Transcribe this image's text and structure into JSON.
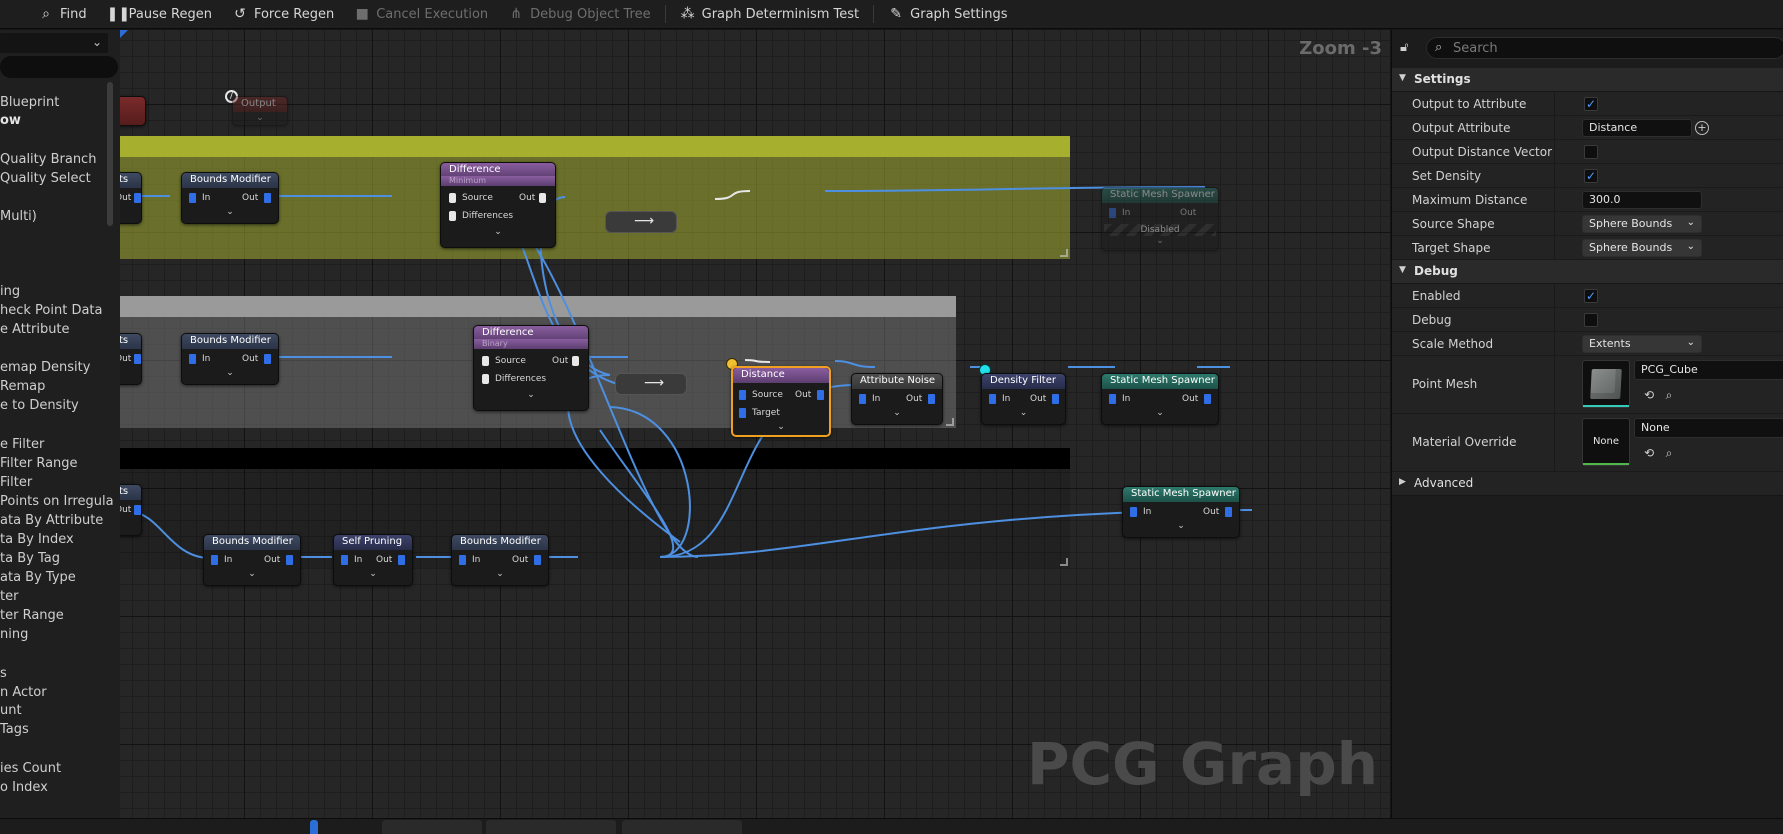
{
  "toolbar": {
    "items": [
      {
        "label": "Find",
        "icon": "find-icon",
        "enabled": true
      },
      {
        "label": "Pause Regen",
        "icon": "pause-icon",
        "enabled": true
      },
      {
        "label": "Force Regen",
        "icon": "refresh-icon",
        "enabled": true
      },
      {
        "label": "Cancel Execution",
        "icon": "stop-icon",
        "enabled": false
      },
      {
        "label": "Debug Object Tree",
        "icon": "debug-tree-icon",
        "enabled": false
      },
      {
        "label": "Graph Determinism Test",
        "icon": "determinism-icon",
        "enabled": true
      },
      {
        "label": "Graph Settings",
        "icon": "graph-settings-icon",
        "enabled": true
      }
    ]
  },
  "palette": {
    "items": [
      {
        "label": "Blueprint",
        "bold": false
      },
      {
        "label": "ow",
        "bold": true
      },
      {
        "label": "Quality Branch",
        "bold": false
      },
      {
        "label": "Quality Select",
        "bold": false
      },
      {
        "label": "Multi)",
        "bold": false
      },
      {
        "label": "ing",
        "bold": false
      },
      {
        "label": "heck Point Data",
        "bold": false
      },
      {
        "label": "e Attribute",
        "bold": false
      },
      {
        "label": "emap Density",
        "bold": false
      },
      {
        "label": "Remap",
        "bold": false
      },
      {
        "label": "e to Density",
        "bold": false
      },
      {
        "label": "e Filter",
        "bold": false
      },
      {
        "label": "Filter Range",
        "bold": false
      },
      {
        "label": "Filter",
        "bold": false
      },
      {
        "label": "Points on Irregula",
        "bold": false
      },
      {
        "label": "ata By Attribute",
        "bold": false
      },
      {
        "label": "ta By Index",
        "bold": false
      },
      {
        "label": "ta By Tag",
        "bold": false
      },
      {
        "label": "ata By Type",
        "bold": false
      },
      {
        "label": "ter",
        "bold": false
      },
      {
        "label": "ter Range",
        "bold": false
      },
      {
        "label": "ning",
        "bold": false
      },
      {
        "label": "s",
        "bold": false
      },
      {
        "label": "n Actor",
        "bold": false
      },
      {
        "label": "unt",
        "bold": false
      },
      {
        "label": "Tags",
        "bold": false
      },
      {
        "label": "ies Count",
        "bold": false
      },
      {
        "label": "o Index",
        "bold": false
      }
    ]
  },
  "graph": {
    "zoom": "Zoom -3",
    "watermark": "PCG Graph",
    "nodes": {
      "top_output": {
        "title": "Output"
      },
      "row1_bounds": {
        "title": "Bounds Modifier",
        "in": "In",
        "out": "Out"
      },
      "row1_difference": {
        "title": "Difference",
        "subtitle": "Minimum",
        "source": "Source",
        "differences": "Differences",
        "out": "Out"
      },
      "row1_spawner": {
        "title": "Static Mesh Spawner",
        "in": "In",
        "out": "Out",
        "status": "Disabled"
      },
      "row2_bounds": {
        "title": "Bounds Modifier",
        "in": "In",
        "out": "Out"
      },
      "row2_difference": {
        "title": "Difference",
        "subtitle": "Binary",
        "source": "Source",
        "differences": "Differences",
        "out": "Out"
      },
      "row2_distance": {
        "title": "Distance",
        "source": "Source",
        "target": "Target",
        "out": "Out"
      },
      "row2_attr_noise": {
        "title": "Attribute Noise",
        "in": "In",
        "out": "Out"
      },
      "row2_density_filter": {
        "title": "Density Filter",
        "in": "In",
        "out": "Out"
      },
      "row2_spawner": {
        "title": "Static Mesh Spawner",
        "in": "In",
        "out": "Out"
      },
      "row3_bounds_a": {
        "title": "Bounds Modifier",
        "in": "In",
        "out": "Out"
      },
      "row3_self_pruning": {
        "title": "Self Pruning",
        "in": "In",
        "out": "Out"
      },
      "row3_bounds_b": {
        "title": "Bounds Modifier",
        "in": "In",
        "out": "Out"
      },
      "row3_spawner": {
        "title": "Static Mesh Spawner",
        "in": "In",
        "out": "Out"
      },
      "left_stub_1": {
        "title": "ts",
        "out": "Out"
      },
      "left_stub_2": {
        "title": "ts",
        "out": "Out"
      },
      "left_stub_3": {
        "title": "ts",
        "out": "Out"
      }
    },
    "colors": {
      "comment_yellow": "#a3ad2f",
      "comment_gray": "#8d8d8d",
      "comment_black": "#000000",
      "wire": "#4d8fe0",
      "wire_white": "#e6e6e6",
      "selection": "#f0a020"
    }
  },
  "details": {
    "search_placeholder": "Search",
    "settings_category": "Settings",
    "rows": {
      "output_to_attribute": {
        "label": "Output to Attribute",
        "checked": true
      },
      "output_attribute": {
        "label": "Output Attribute",
        "value": "Distance"
      },
      "output_distance_vector": {
        "label": "Output Distance Vector",
        "checked": false
      },
      "set_density": {
        "label": "Set Density",
        "checked": true
      },
      "maximum_distance": {
        "label": "Maximum Distance",
        "value": "300.0"
      },
      "source_shape": {
        "label": "Source Shape",
        "value": "Sphere Bounds"
      },
      "target_shape": {
        "label": "Target Shape",
        "value": "Sphere Bounds"
      }
    },
    "debug_category": "Debug",
    "debug_rows": {
      "enabled": {
        "label": "Enabled",
        "checked": true
      },
      "debug": {
        "label": "Debug",
        "checked": false
      },
      "scale_method": {
        "label": "Scale Method",
        "value": "Extents"
      },
      "point_mesh": {
        "label": "Point Mesh",
        "value": "PCG_Cube"
      },
      "material_override": {
        "label": "Material Override",
        "value": "None",
        "thumb": "None"
      }
    },
    "advanced_category": "Advanced"
  }
}
